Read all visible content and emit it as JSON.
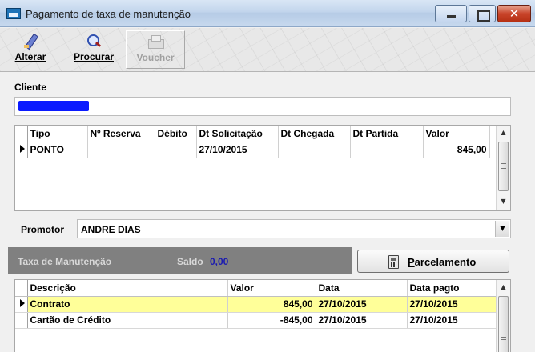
{
  "window": {
    "title": "Pagamento de taxa de manutenção",
    "close_glyph": "✕"
  },
  "toolbar": {
    "alterar": {
      "label": "Alterar",
      "icon": "pencil-icon",
      "enabled": true
    },
    "procurar": {
      "label": "Procurar",
      "icon": "search-icon",
      "enabled": true
    },
    "voucher": {
      "label": "Voucher",
      "icon": "printer-icon",
      "enabled": false
    }
  },
  "cliente": {
    "label": "Cliente",
    "value_redacted": true,
    "redaction_color": "#0a1aff"
  },
  "reservas": {
    "columns": [
      "Tipo",
      "Nº Reserva",
      "Débito",
      "Dt Solicitação",
      "Dt Chegada",
      "Dt Partida",
      "Valor"
    ],
    "rows": [
      {
        "tipo": "PONTO",
        "reserva": "",
        "debito": "",
        "dt_solicitacao": "27/10/2015",
        "dt_chegada": "",
        "dt_partida": "",
        "valor": "845,00",
        "current": true
      }
    ]
  },
  "promotor": {
    "label": "Promotor",
    "value": "ANDRE DIAS"
  },
  "taxa": {
    "label": "Taxa de Manutenção",
    "saldo_label": "Saldo",
    "saldo_value": "0,00",
    "bar_color": "#808080"
  },
  "parcelamento": {
    "label_first": "P",
    "label_rest": "arcelamento",
    "icon": "calculator-icon"
  },
  "pagamentos": {
    "columns": [
      "Descrição",
      "Valor",
      "Data",
      "Data pagto"
    ],
    "rows": [
      {
        "descricao": "Contrato",
        "valor": "845,00",
        "data": "27/10/2015",
        "data_pagto": "27/10/2015",
        "current": true
      },
      {
        "descricao": "Cartão de Crédito",
        "valor": "-845,00",
        "data": "27/10/2015",
        "data_pagto": "27/10/2015",
        "current": false
      }
    ],
    "highlight_color": "#ffff99"
  }
}
